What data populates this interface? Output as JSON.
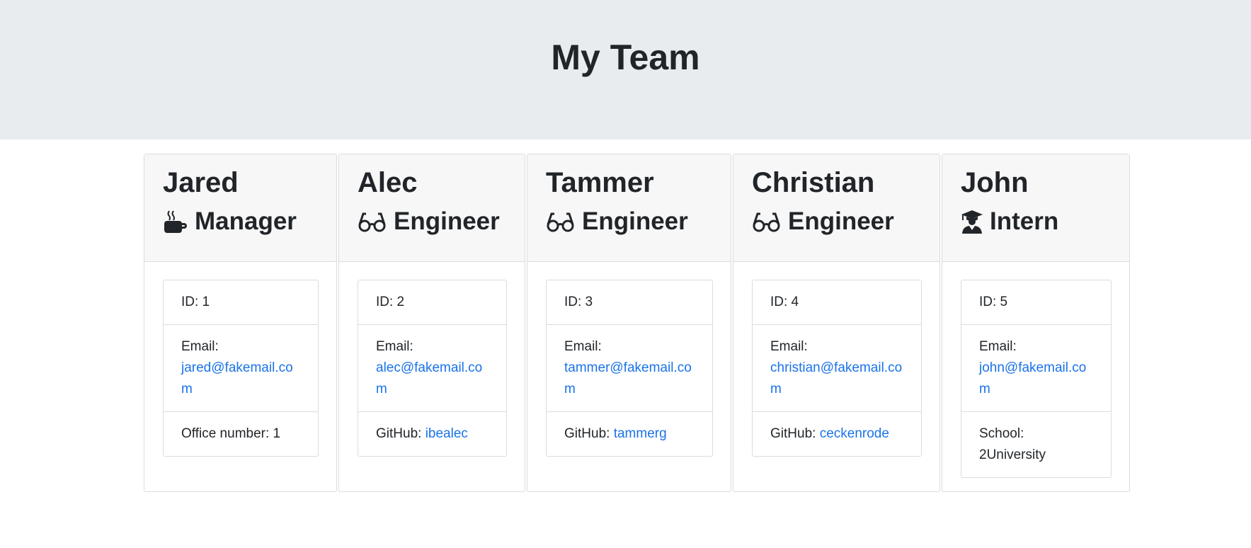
{
  "header": {
    "title": "My Team"
  },
  "team": [
    {
      "name": "Jared",
      "role": "Manager",
      "icon": "coffee-icon",
      "id_label": "ID: 1",
      "email_label": "Email:",
      "email": "jared@fakemail.com",
      "extra_label": "Office number: 1",
      "extra_link": ""
    },
    {
      "name": "Alec",
      "role": "Engineer",
      "icon": "glasses-icon",
      "id_label": "ID: 2",
      "email_label": "Email:",
      "email": "alec@fakemail.com",
      "extra_label": "GitHub:",
      "extra_link": "ibealec"
    },
    {
      "name": "Tammer",
      "role": "Engineer",
      "icon": "glasses-icon",
      "id_label": "ID: 3",
      "email_label": "Email:",
      "email": "tammer@fakemail.com",
      "extra_label": "GitHub:",
      "extra_link": "tammerg"
    },
    {
      "name": "Christian",
      "role": "Engineer",
      "icon": "glasses-icon",
      "id_label": "ID: 4",
      "email_label": "Email:",
      "email": "christian@fakemail.com",
      "extra_label": "GitHub:",
      "extra_link": "ceckenrode"
    },
    {
      "name": "John",
      "role": "Intern",
      "icon": "graduate-icon",
      "id_label": "ID: 5",
      "email_label": "Email:",
      "email": "john@fakemail.com",
      "extra_label": "School: 2University",
      "extra_link": ""
    }
  ],
  "colors": {
    "link": "#1a73e8",
    "header_bg": "#e9ecef",
    "card_header_bg": "#f7f7f7"
  }
}
